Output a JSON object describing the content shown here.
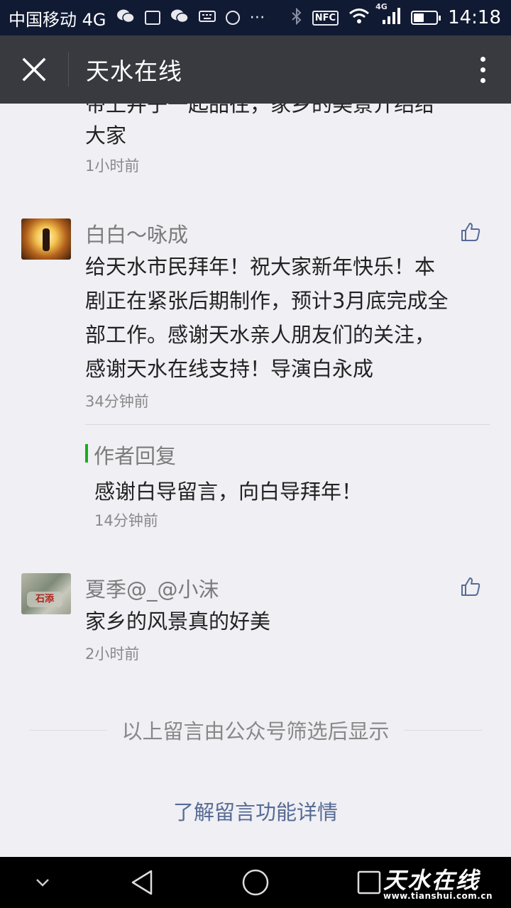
{
  "status_bar": {
    "carrier": "中国移动 4G",
    "signal_label": "4G",
    "time": "14:18",
    "nfc_label": "NFC",
    "icons": [
      "wechat-icon",
      "image-icon",
      "wechat-icon",
      "keyboard-icon",
      "sync-icon",
      "more-dots-icon",
      "bluetooth-icon",
      "nfc-icon",
      "wifi-icon",
      "signal-icon",
      "battery-icon"
    ]
  },
  "title_bar": {
    "title": "天水在线",
    "close_icon": "close-icon",
    "more_icon": "more-vertical-icon"
  },
  "previous_comment": {
    "partial_text": "带上井子一起品往，家乡的美景介绍给",
    "text_end": "大家",
    "time": "1小时前"
  },
  "comments": [
    {
      "nickname": "白白～咏成",
      "text_lines": [
        "给天水市民拜年！祝大家新年快乐！本",
        "剧正在紧张后期制作，预计3月底完成全",
        "部工作。感谢天水亲人朋友们的关注，",
        "感谢天水在线支持！导演白永成"
      ],
      "time": "34分钟前",
      "reply": {
        "label": "作者回复",
        "text": "感谢白导留言，向白导拜年！",
        "time": "14分钟前"
      }
    },
    {
      "nickname": "夏季@_@小沫",
      "avatar_text": "石添",
      "text_lines": [
        "家乡的风景真的好美"
      ],
      "time": "2小时前"
    }
  ],
  "footer": {
    "filter_note": "以上留言由公众号筛选后显示",
    "learn_more": "了解留言功能详情"
  },
  "nav_bar": {
    "icons": [
      "chevron-down-icon",
      "back-triangle-icon",
      "home-circle-icon",
      "recents-square-icon"
    ]
  },
  "watermark": {
    "title": "天水在线",
    "url": "www.tianshui.com.cn"
  },
  "colors": {
    "status_bar_bg": "#101a33",
    "title_bar_bg": "#393a3f",
    "page_bg": "#efeff4",
    "link": "#576b95",
    "reply_accent": "#1aad19"
  }
}
